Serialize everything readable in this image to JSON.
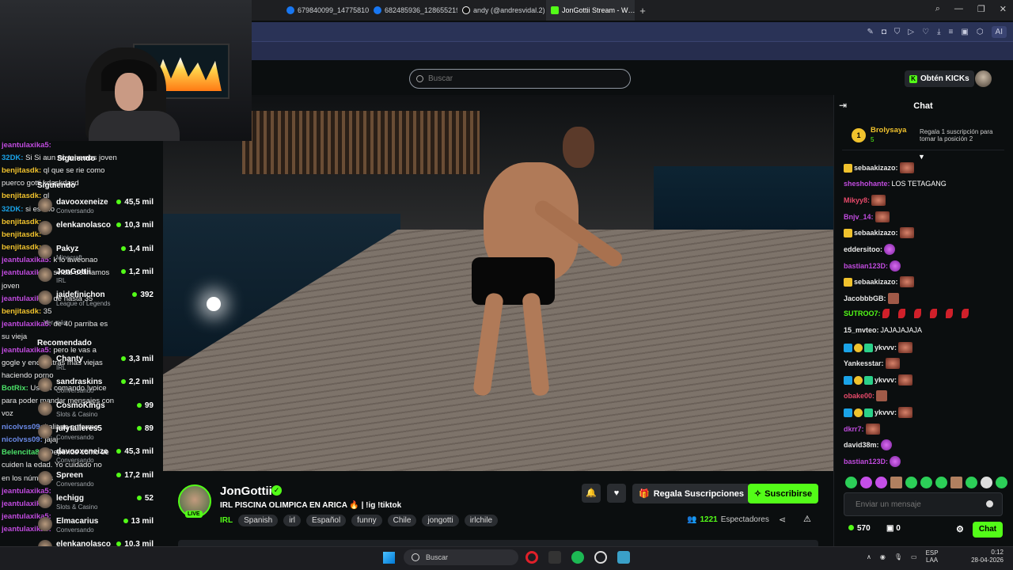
{
  "browser": {
    "tabs": [
      {
        "label": "n",
        "active": false
      },
      {
        "label": "679840099_1477581087…",
        "active": false
      },
      {
        "label": "682485936_12865521995…",
        "active": false
      },
      {
        "label": "andy (@andresvidal.2) | Ti…",
        "active": false
      },
      {
        "label": "JonGottii Stream - W…",
        "active": true
      }
    ],
    "ai_label": "AI"
  },
  "header": {
    "search_placeholder": "Buscar",
    "kicks_label": "Obtén KICKs"
  },
  "left_chat": [
    {
      "user": "jeantulaxika5:",
      "text": "",
      "color": "c1"
    },
    {
      "user": "32DK:",
      "text": "Si Si aun no tenemos joven",
      "color": "c2"
    },
    {
      "user": "benjitasdk:",
      "text": "ql que se rie como",
      "color": "c3"
    },
    {
      "user": "",
      "text": "puerco gotti kdaskdasd",
      "color": ""
    },
    {
      "user": "benjitasdk:",
      "text": "ql",
      "color": "c3"
    },
    {
      "user": "32DK:",
      "text": "si es ello",
      "color": "c2"
    },
    {
      "user": "benjitasdk:",
      "text": "",
      "color": "c3"
    },
    {
      "user": "benjitasdk:",
      "text": "",
      "color": "c3"
    },
    {
      "user": "benjitasdk:",
      "text": "",
      "color": "c3"
    },
    {
      "user": "jeantulaxika5:",
      "text": "k lo aweonao",
      "color": "c1"
    },
    {
      "user": "jeantulaxika5:",
      "text": "svidal definamos",
      "color": "c1"
    },
    {
      "user": "",
      "text": "joven",
      "color": ""
    },
    {
      "user": "jeantulaxika5:",
      "text": "de hasta 35",
      "color": "c1"
    },
    {
      "user": "benjitasdk:",
      "text": "35",
      "color": "c3"
    },
    {
      "user": "jeantulaxika5:",
      "text": "de 40 parriba es",
      "color": "c1"
    },
    {
      "user": "",
      "text": "su vieja",
      "color": ""
    },
    {
      "user": "jeantulaxika5:",
      "text": "pero le vas a",
      "color": "c1"
    },
    {
      "user": "",
      "text": "gogle y encuentras mas viejas",
      "color": ""
    },
    {
      "user": "",
      "text": "haciendo porno",
      "color": ""
    },
    {
      "user": "BotRix:",
      "text": "Usa el comando !voice",
      "color": "c4"
    },
    {
      "user": "",
      "text": "para poder mandar mensajes con",
      "color": ""
    },
    {
      "user": "",
      "text": "voz",
      "color": ""
    },
    {
      "user": "nicolvss09:",
      "text": "italiano enfermo",
      "color": "c5"
    },
    {
      "user": "nicolvss09:",
      "text": "jajaj",
      "color": "c5"
    },
    {
      "user": "Belencita88:",
      "text": "Depende como se",
      "color": "c4"
    },
    {
      "user": "",
      "text": "cuiden la edad. Yo cuidado no",
      "color": ""
    },
    {
      "user": "",
      "text": "en los números",
      "color": ""
    },
    {
      "user": "jeantulaxika5:",
      "text": "",
      "color": "c1"
    },
    {
      "user": "jeantulaxika5:",
      "text": "",
      "color": "c1"
    },
    {
      "user": "jeantulaxika5:",
      "text": "",
      "color": "c1"
    },
    {
      "user": "jeantulaxika5:",
      "text": "",
      "color": "c1"
    }
  ],
  "sidebar": {
    "following_title": "Siguiendo",
    "following_title2": "Siguiendo",
    "following": [
      {
        "name": "davooxeneize",
        "sub": "Conversando",
        "viewers": "45,5 mil"
      },
      {
        "name": "elenkanolasco",
        "sub": "",
        "viewers": "10,3 mil"
      },
      {
        "name": "Pakyz",
        "sub": "Minecraft",
        "viewers": "1,4 mil"
      },
      {
        "name": "JonGottii",
        "sub": "IRL",
        "viewers": "1,2 mil"
      },
      {
        "name": "jaidefinichon",
        "sub": "League of Legends",
        "viewers": "392"
      }
    ],
    "more_label": "Ver más",
    "recommended_title": "Recomendado",
    "recommended": [
      {
        "name": "Chanty",
        "sub": "IRL",
        "viewers": "3,3 mil"
      },
      {
        "name": "sandraskins",
        "sub": "Conversando",
        "viewers": "2,2 mil"
      },
      {
        "name": "CosmoKings",
        "sub": "Slots & Casino",
        "viewers": "99"
      },
      {
        "name": "julytalleres5",
        "sub": "Conversando",
        "viewers": "89"
      },
      {
        "name": "davooxeneize",
        "sub": "Conversando",
        "viewers": "45,3 mil"
      },
      {
        "name": "Spreen",
        "sub": "Conversando",
        "viewers": "17,2 mil"
      },
      {
        "name": "lechigg",
        "sub": "Slots & Casino",
        "viewers": "52"
      },
      {
        "name": "Elmacarius",
        "sub": "Conversando",
        "viewers": "13 mil"
      },
      {
        "name": "elenkanolasco",
        "sub": "",
        "viewers": "10,3 mil"
      }
    ]
  },
  "stream": {
    "channel": "JonGottii",
    "live_badge": "LIVE",
    "title": "IRL PISCINA OLIMPICA EN ARICA 🔥 | !ig !tiktok",
    "category": "IRL",
    "tags": [
      "Spanish",
      "irl",
      "Español",
      "funny",
      "Chile",
      "jongotti",
      "irlchile"
    ],
    "gift_label": "Regala Suscripciones",
    "subscribe_label": "Suscribirse",
    "viewers_count": "1221",
    "viewers_label": "Espectadores"
  },
  "chat": {
    "title": "Chat",
    "pinned": {
      "rank": "1",
      "name": "Brolysaya",
      "value": "5",
      "text": "Regala 1 suscripción para tomar la posición 2"
    },
    "messages": [
      {
        "user": "sebaakizazo:",
        "text": "",
        "color": "#e8e8e8",
        "badges": [
          "crown"
        ],
        "emotes": [
          "e"
        ]
      },
      {
        "user": "sheshohante:",
        "text": "LOS TETAGANG",
        "color": "#c04bde",
        "badges": [],
        "emotes": []
      },
      {
        "user": "Mikyy8:",
        "text": "",
        "color": "#e64a6a",
        "badges": [],
        "emotes": [
          "e"
        ]
      },
      {
        "user": "Bnjv_14:",
        "text": "",
        "color": "#c04bde",
        "badges": [],
        "emotes": [
          "e"
        ]
      },
      {
        "user": "sebaakizazo:",
        "text": "",
        "color": "#e8e8e8",
        "badges": [
          "crown"
        ],
        "emotes": [
          "e"
        ]
      },
      {
        "user": "eddersitoo:",
        "text": "",
        "color": "#e8e8e8",
        "badges": [],
        "emotes": [
          "p"
        ]
      },
      {
        "user": "bastian123D:",
        "text": "",
        "color": "#c04bde",
        "badges": [],
        "emotes": [
          "p"
        ]
      },
      {
        "user": "sebaakizazo:",
        "text": "",
        "color": "#e8e8e8",
        "badges": [
          "crown"
        ],
        "emotes": [
          "e"
        ]
      },
      {
        "user": "JacobbbGB:",
        "text": "",
        "color": "#e8e8e8",
        "badges": [],
        "emotes": [
          "s"
        ]
      },
      {
        "user": "SUTROO7:",
        "text": "",
        "color": "#53fc18",
        "badges": [],
        "emotes": [
          "r",
          "r",
          "r",
          "r",
          "r",
          "r"
        ]
      },
      {
        "user": "15_mvteo:",
        "text": "JAJAJAJAJA",
        "color": "#e8e8e8",
        "badges": [],
        "emotes": []
      },
      {
        "user": "ykvvv:",
        "text": "",
        "color": "#e8e8e8",
        "badges": [
          "blue",
          "gold",
          "green"
        ],
        "emotes": [
          "e"
        ]
      },
      {
        "user": "Yankesstar:",
        "text": "",
        "color": "#e8e8e8",
        "badges": [],
        "emotes": [
          "e"
        ]
      },
      {
        "user": "ykvvv:",
        "text": "",
        "color": "#e8e8e8",
        "badges": [
          "blue",
          "gold",
          "green"
        ],
        "emotes": [
          "e"
        ]
      },
      {
        "user": "obake00:",
        "text": "",
        "color": "#e64a6a",
        "badges": [],
        "emotes": [
          "s"
        ]
      },
      {
        "user": "ykvvv:",
        "text": "",
        "color": "#e8e8e8",
        "badges": [
          "blue",
          "gold",
          "green"
        ],
        "emotes": [
          "e"
        ]
      },
      {
        "user": "dkrr7:",
        "text": "",
        "color": "#c04bde",
        "badges": [],
        "emotes": [
          "e"
        ]
      },
      {
        "user": "david38m:",
        "text": "",
        "color": "#e8e8e8",
        "badges": [],
        "emotes": [
          "p"
        ]
      },
      {
        "user": "bastian123D:",
        "text": "",
        "color": "#c04bde",
        "badges": [],
        "emotes": [
          "p"
        ]
      }
    ],
    "input_placeholder": "Enviar un mensaje",
    "points": "570",
    "gifts": "0",
    "send_label": "Chat"
  },
  "taskbar": {
    "search_placeholder": "Buscar",
    "lang_top": "ESP",
    "lang_bottom": "LAA",
    "time": "0:12",
    "date": "28-04-2026"
  },
  "colors": {
    "accent": "#53fc18",
    "background": "#0b0e0f",
    "address_bar": "#2a3357"
  }
}
